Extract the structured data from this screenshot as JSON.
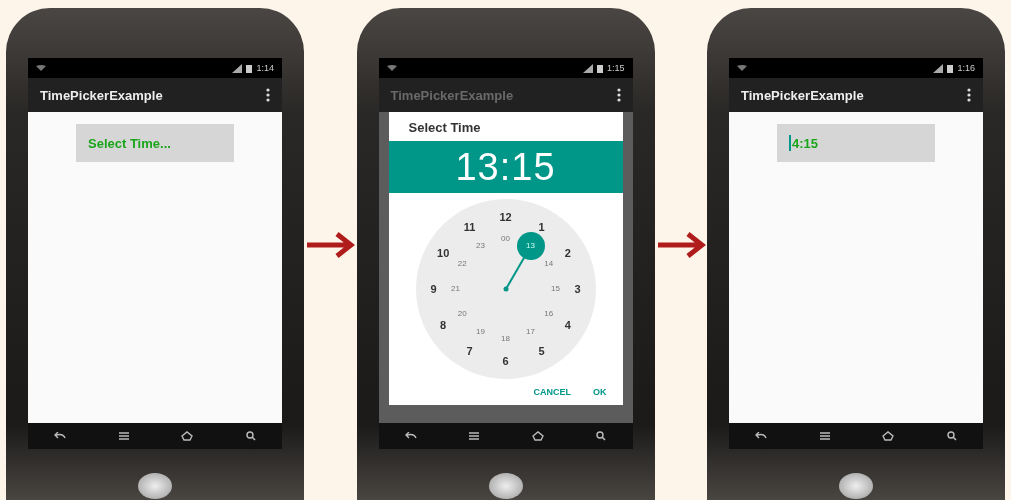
{
  "screens": [
    {
      "kind": "main",
      "status_time": "1:14",
      "app_title": "TimePickerExample",
      "field": {
        "text": "Select Time...",
        "cursor": false
      }
    },
    {
      "kind": "dialog",
      "status_time": "1:15",
      "app_title": "TimePickerExample",
      "dialog": {
        "title": "Select Time",
        "header_time": "13:15",
        "hours_outer": [
          "12",
          "1",
          "2",
          "3",
          "4",
          "5",
          "6",
          "7",
          "8",
          "9",
          "10",
          "11"
        ],
        "hours_inner": [
          {
            "label": "00",
            "selected": false
          },
          {
            "label": "13",
            "selected": true
          },
          {
            "label": "14",
            "selected": false
          },
          {
            "label": "15",
            "selected": false
          },
          {
            "label": "16",
            "selected": false
          },
          {
            "label": "17",
            "selected": false
          },
          {
            "label": "18",
            "selected": false
          },
          {
            "label": "19",
            "selected": false
          },
          {
            "label": "20",
            "selected": false
          },
          {
            "label": "21",
            "selected": false
          },
          {
            "label": "22",
            "selected": false
          },
          {
            "label": "23",
            "selected": false
          }
        ],
        "buttons": [
          "CANCEL",
          "OK"
        ]
      }
    },
    {
      "kind": "main",
      "status_time": "1:16",
      "app_title": "TimePickerExample",
      "field": {
        "text": "4:15",
        "cursor": true
      }
    }
  ]
}
